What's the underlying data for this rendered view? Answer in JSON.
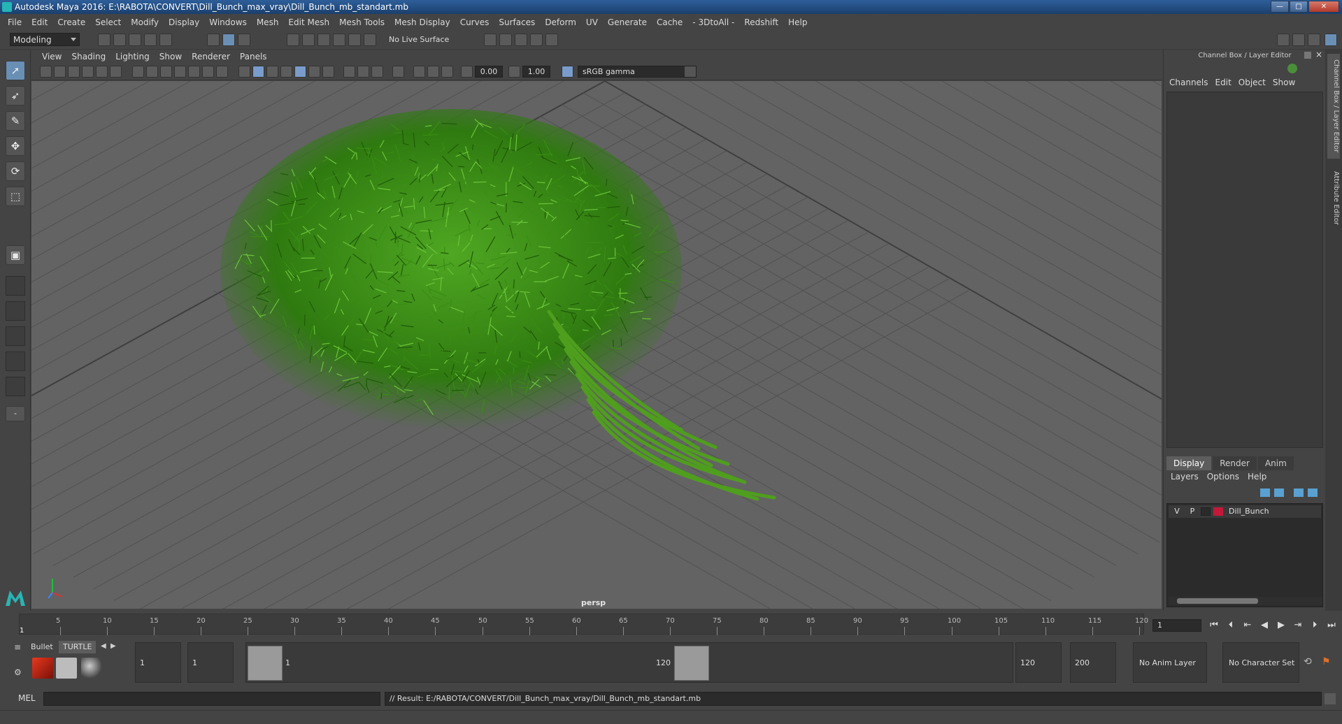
{
  "window": {
    "title": "Autodesk Maya 2016: E:\\RABOTA\\CONVERT\\Dill_Bunch_max_vray\\Dill_Bunch_mb_standart.mb",
    "minimize": "—",
    "maximize": "□",
    "close": "✕"
  },
  "menubar": {
    "items": [
      "File",
      "Edit",
      "Create",
      "Select",
      "Modify",
      "Display",
      "Windows",
      "Mesh",
      "Edit Mesh",
      "Mesh Tools",
      "Mesh Display",
      "Curves",
      "Surfaces",
      "Deform",
      "UV",
      "Generate",
      "Cache",
      "- 3DtoAll -",
      "Redshift",
      "Help"
    ]
  },
  "statusline": {
    "mode": "Modeling",
    "live_surface": "No Live Surface"
  },
  "viewport": {
    "menu": [
      "View",
      "Shading",
      "Lighting",
      "Show",
      "Renderer",
      "Panels"
    ],
    "exposure": "0.00",
    "gamma_value": "1.00",
    "color_space": "sRGB gamma",
    "camera": "persp",
    "colors": {
      "background": "#636363",
      "grid": "#515151",
      "grid_axis": "#3f3f3f",
      "foliage": "#3a8c14",
      "stem": "#4f9e1e"
    }
  },
  "right_panel": {
    "title": "Channel Box / Layer Editor",
    "menu": [
      "Channels",
      "Edit",
      "Object",
      "Show"
    ],
    "tabs": [
      "Display",
      "Render",
      "Anim"
    ],
    "active_tab": "Display",
    "layer_menu": [
      "Layers",
      "Options",
      "Help"
    ],
    "layers": [
      {
        "visible": "V",
        "playback": "P",
        "name": "Dill_Bunch",
        "color": "#c4183a"
      }
    ],
    "side_tabs": [
      "Channel Box / Layer Editor",
      "Attribute Editor"
    ]
  },
  "timeline": {
    "current_frame": "1",
    "ticks": [
      "5",
      "10",
      "15",
      "20",
      "25",
      "30",
      "35",
      "40",
      "45",
      "50",
      "55",
      "60",
      "65",
      "70",
      "75",
      "80",
      "85",
      "90",
      "95",
      "100",
      "105",
      "110",
      "115",
      "120"
    ],
    "frame_field": "1"
  },
  "range": {
    "shelf_tabs": [
      "Bullet",
      "TURTLE"
    ],
    "start_time": "1",
    "playback_start": "1",
    "range_start_label": "1",
    "range_end_label": "120",
    "playback_end": "120",
    "end_time": "200",
    "anim_layer": "No Anim Layer",
    "character_set": "No Character Set"
  },
  "command": {
    "language": "MEL",
    "result": "// Result: E:/RABOTA/CONVERT/Dill_Bunch_max_vray/Dill_Bunch_mb_standart.mb"
  }
}
